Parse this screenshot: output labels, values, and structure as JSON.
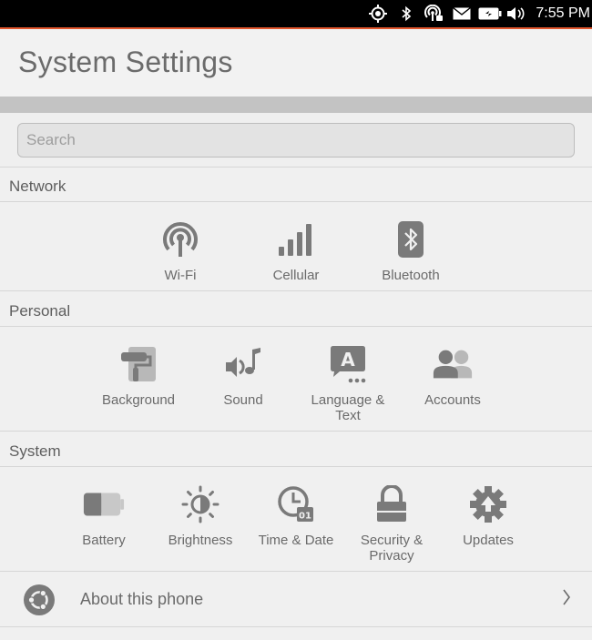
{
  "status_bar": {
    "time": "7:55 PM",
    "icons": [
      "location-icon",
      "bluetooth-icon",
      "hotspot-icon",
      "mail-icon",
      "battery-icon",
      "volume-icon"
    ]
  },
  "header": {
    "title": "System Settings"
  },
  "search": {
    "placeholder": "Search",
    "value": ""
  },
  "sections": {
    "network": {
      "title": "Network",
      "items": [
        {
          "label": "Wi-Fi",
          "icon": "wifi-icon"
        },
        {
          "label": "Cellular",
          "icon": "cellular-icon"
        },
        {
          "label": "Bluetooth",
          "icon": "bluetooth-icon"
        }
      ]
    },
    "personal": {
      "title": "Personal",
      "items": [
        {
          "label": "Background",
          "icon": "paint-roller-icon"
        },
        {
          "label": "Sound",
          "icon": "sound-icon"
        },
        {
          "label": "Language & Text",
          "icon": "language-icon"
        },
        {
          "label": "Accounts",
          "icon": "accounts-icon"
        }
      ]
    },
    "system": {
      "title": "System",
      "items": [
        {
          "label": "Battery",
          "icon": "battery-icon"
        },
        {
          "label": "Brightness",
          "icon": "brightness-icon"
        },
        {
          "label": "Time & Date",
          "icon": "clock-icon"
        },
        {
          "label": "Security & Privacy",
          "icon": "lock-icon"
        },
        {
          "label": "Updates",
          "icon": "updates-icon"
        }
      ]
    }
  },
  "about": {
    "label": "About this phone"
  },
  "colors": {
    "accent": "#e1562d",
    "icon": "#7a7a7a",
    "background": "#f0f0f0"
  }
}
